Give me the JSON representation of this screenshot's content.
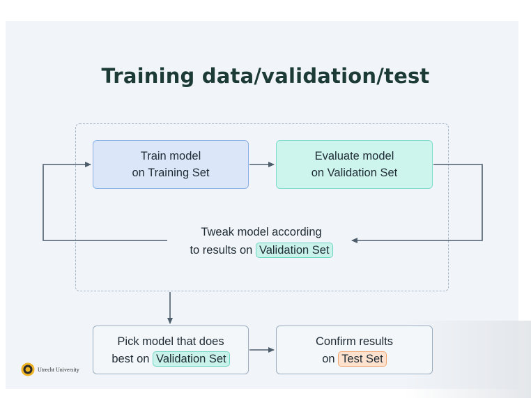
{
  "title": "Training data/validation/test",
  "boxes": {
    "train": {
      "line1": "Train model",
      "line2": "on Training Set"
    },
    "evaluate": {
      "line1": "Evaluate model",
      "line2": "on Validation Set"
    },
    "pick": {
      "line1": "Pick model that does",
      "prefix": "best on",
      "chip": "Validation Set"
    },
    "confirm": {
      "line1": "Confirm results",
      "prefix": "on",
      "chip": "Test Set"
    }
  },
  "tweak": {
    "line1": "Tweak model according",
    "prefix": "to results on",
    "chip": "Validation Set"
  },
  "logo": {
    "text": "Utrecht University"
  },
  "colors": {
    "title": "#1c3a36",
    "blue_box": "#dbe7f8",
    "teal_box": "#cdf5ee",
    "orange_chip": "#fde3cf",
    "arrow": "#4d5d6c"
  }
}
